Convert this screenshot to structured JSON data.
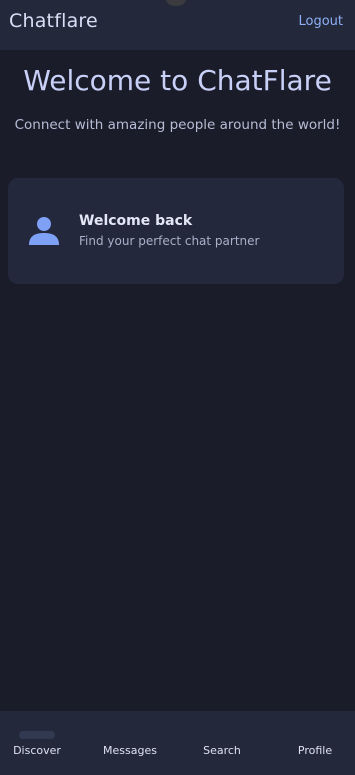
{
  "app_bar": {
    "title": "Chatflare",
    "logout_label": "Logout"
  },
  "hero": {
    "title": "Welcome to ChatFlare",
    "subtitle": "Connect with amazing people around the world!"
  },
  "welcome_card": {
    "icon": "person-icon",
    "title": "Welcome back",
    "subtitle": "Find your perfect chat partner"
  },
  "bottom_nav": {
    "items": [
      {
        "label": "Discover",
        "selected": true
      },
      {
        "label": "Messages",
        "selected": false
      },
      {
        "label": "Search",
        "selected": false
      },
      {
        "label": "Profile",
        "selected": false
      }
    ]
  },
  "colors": {
    "background": "#1b1c29",
    "bar": "#23283b",
    "card": "#24283d",
    "accent": "#8fb0f8",
    "icon": "#7ea1f5"
  }
}
